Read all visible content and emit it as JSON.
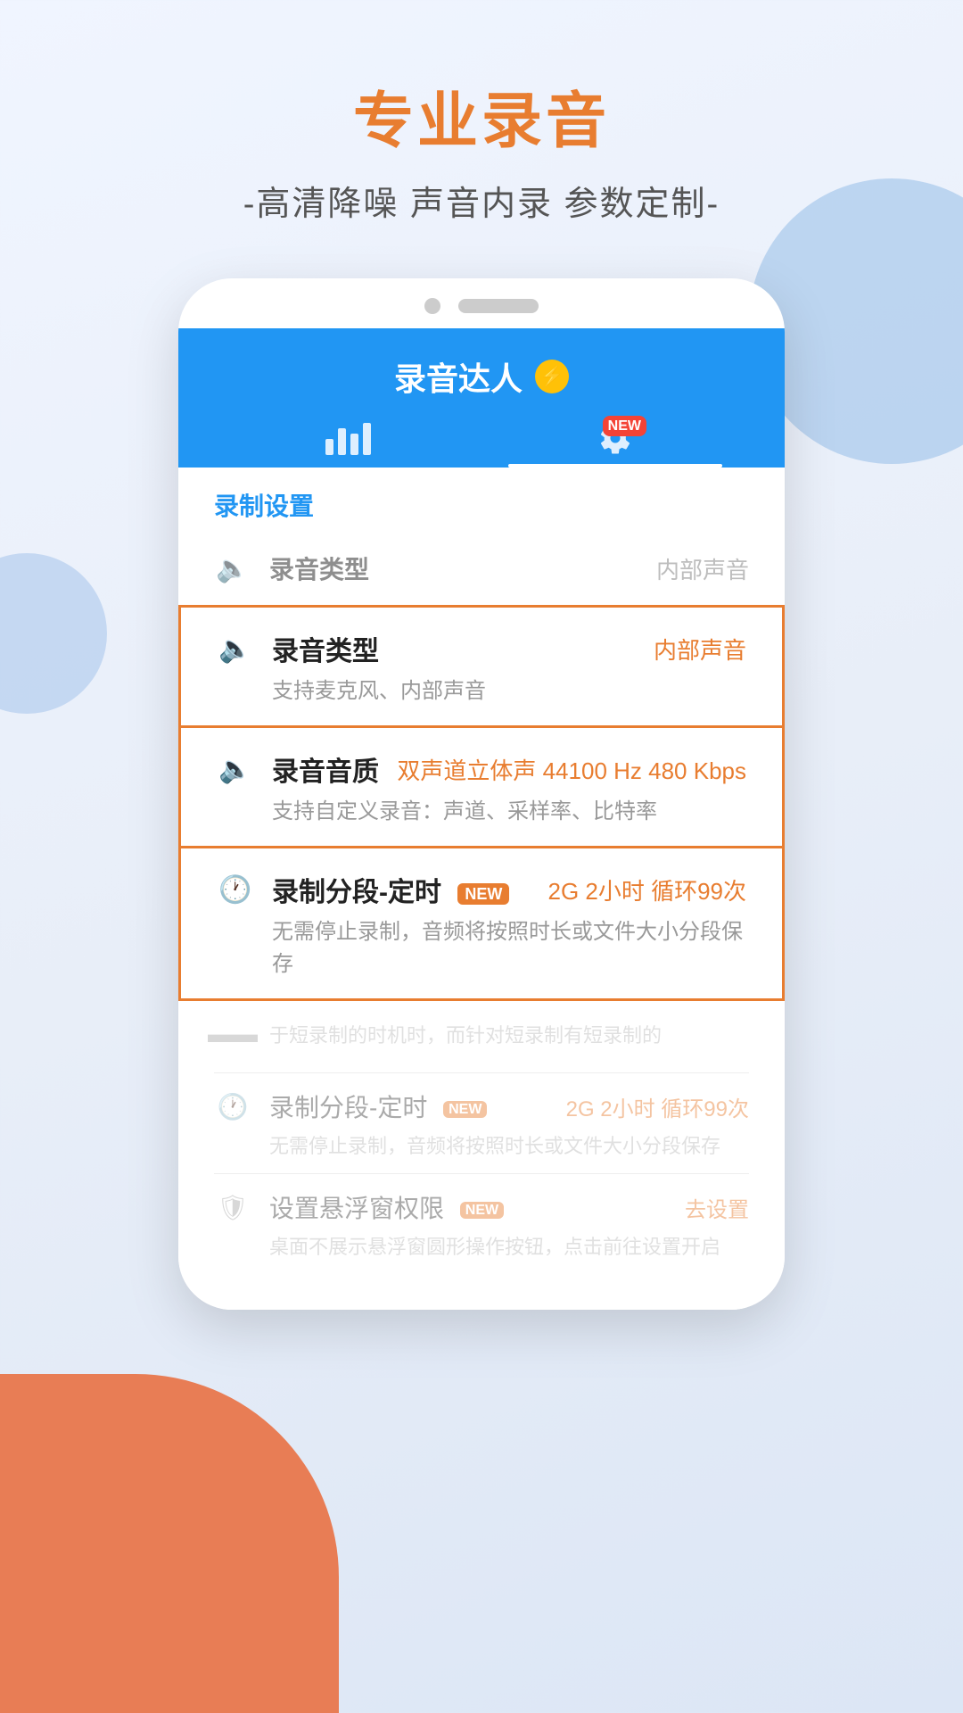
{
  "page": {
    "background": "#e8eef8"
  },
  "header": {
    "main_title": "专业录音",
    "sub_title": "-高清降噪 声音内录 参数定制-"
  },
  "app": {
    "title": "录音达人",
    "tabs": [
      {
        "id": "recordings",
        "icon": "bars",
        "active": false
      },
      {
        "id": "settings",
        "icon": "gear",
        "active": true,
        "badge": "NEW"
      }
    ],
    "settings_label": "录制设置"
  },
  "setting_rows_bg": [
    {
      "icon": "speaker",
      "label": "录音类型",
      "value": "内部声音"
    }
  ],
  "highlighted_rows": [
    {
      "icon": "speaker",
      "label": "录音类型",
      "value": "内部声音",
      "desc": "支持麦克风、内部声音",
      "has_new": false
    },
    {
      "icon": "speaker",
      "label": "录音音质",
      "value": "双声道立体声 44100 Hz 480 Kbps",
      "desc": "支持自定义录音：声道、采样率、比特率",
      "has_new": false
    },
    {
      "icon": "clock",
      "label": "录制分段-定时",
      "value": "2G 2小时 循环99次",
      "desc": "无需停止录制，音频将按照时长或文件大小分段保存",
      "has_new": true,
      "new_tag": "NEW"
    }
  ],
  "lower_rows": [
    {
      "icon": "clock",
      "label": "录制分段-定时",
      "value": "2G 2小时 循环99次",
      "desc": "无需停止录制，音频将按照时长或文件大小分段保存",
      "has_new": true,
      "new_tag": "NEW"
    },
    {
      "icon": "shield",
      "label": "设置悬浮窗权限",
      "value": "去设置",
      "desc": "桌面不展示悬浮窗圆形操作按钮，点击前往设置开启",
      "has_new": true,
      "new_tag": "NEW"
    }
  ]
}
